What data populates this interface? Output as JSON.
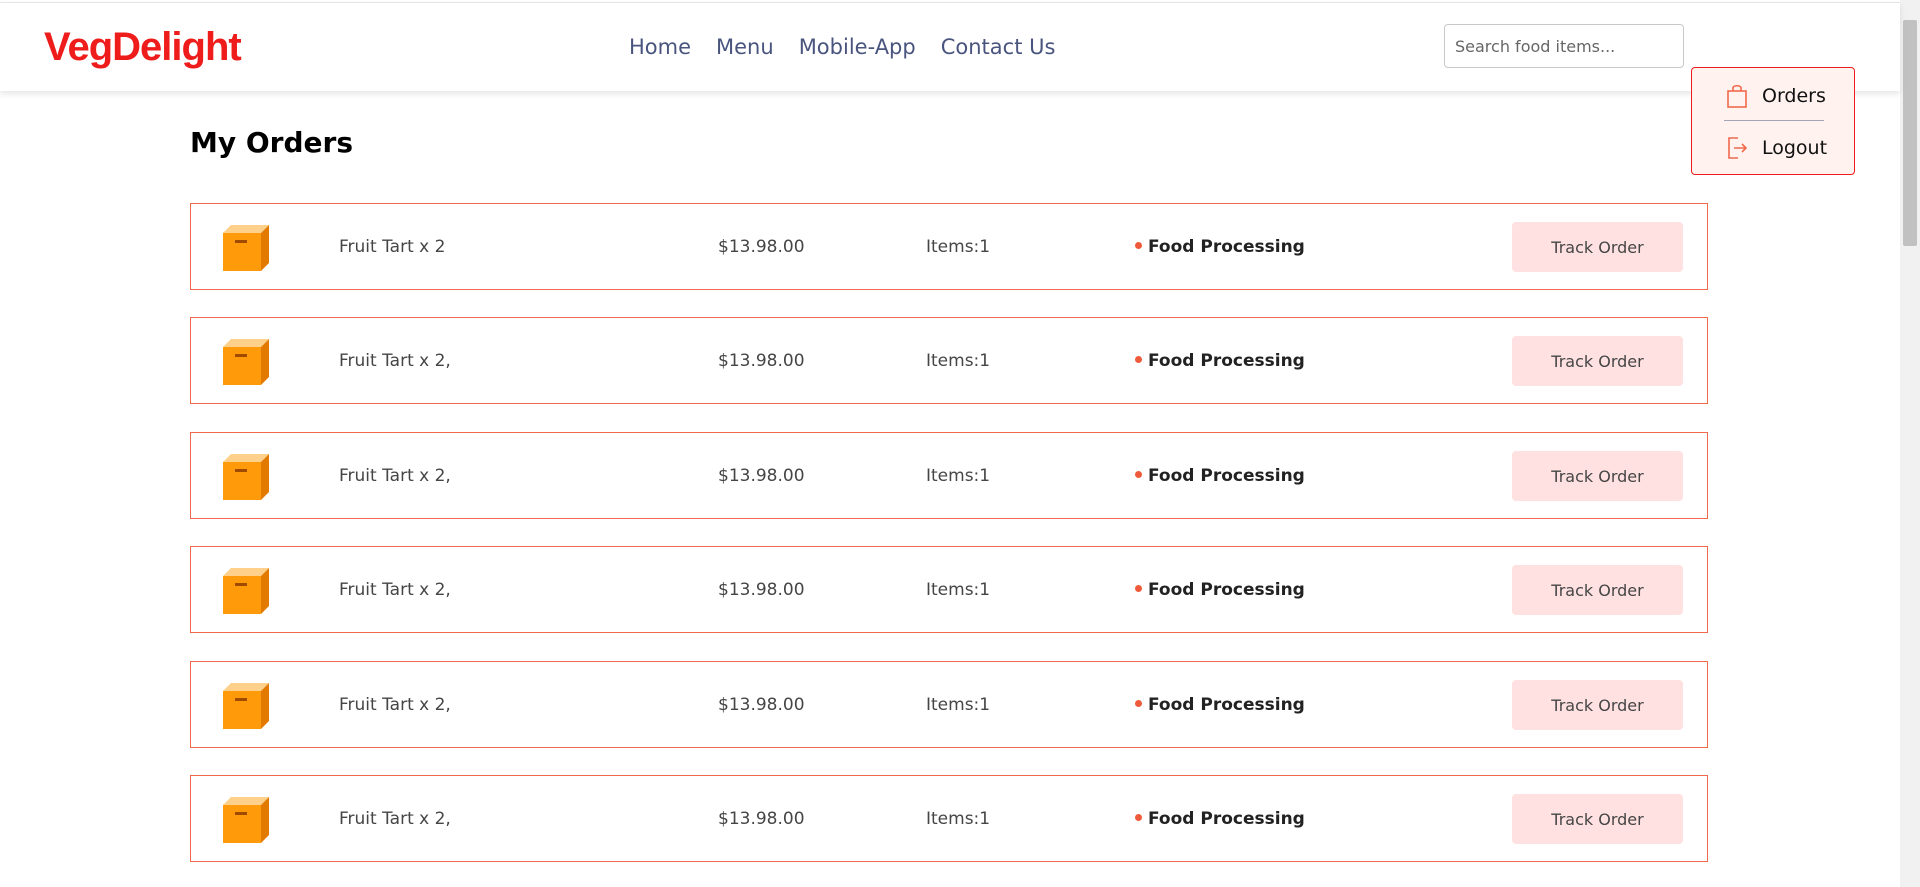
{
  "header": {
    "logo": "VegDelight",
    "nav": [
      "Home",
      "Menu",
      "Mobile-App",
      "Contact Us"
    ],
    "search_placeholder": "Search food items...",
    "accent_color": "#ef1c1c",
    "nav_color": "#49557e"
  },
  "icons": {
    "search": "search-icon",
    "basket": "basket-icon",
    "profile": "profile-icon",
    "order_box": "package-box-icon",
    "orders_bag": "shopping-bag-icon",
    "logout": "logout-icon"
  },
  "dropdown": {
    "orders_label": "Orders",
    "logout_label": "Logout"
  },
  "main": {
    "title": "My Orders",
    "track_label": "Track Order",
    "orders": [
      {
        "items": "Fruit Tart x 2",
        "amount": "$13.98.00",
        "count": "Items:1",
        "status": "Food Processing"
      },
      {
        "items": "Fruit Tart x 2,",
        "amount": "$13.98.00",
        "count": "Items:1",
        "status": "Food Processing"
      },
      {
        "items": "Fruit Tart x 2,",
        "amount": "$13.98.00",
        "count": "Items:1",
        "status": "Food Processing"
      },
      {
        "items": "Fruit Tart x 2,",
        "amount": "$13.98.00",
        "count": "Items:1",
        "status": "Food Processing"
      },
      {
        "items": "Fruit Tart x 2,",
        "amount": "$13.98.00",
        "count": "Items:1",
        "status": "Food Processing"
      },
      {
        "items": "Fruit Tart x 2,",
        "amount": "$13.98.00",
        "count": "Items:1",
        "status": "Food Processing"
      }
    ]
  }
}
